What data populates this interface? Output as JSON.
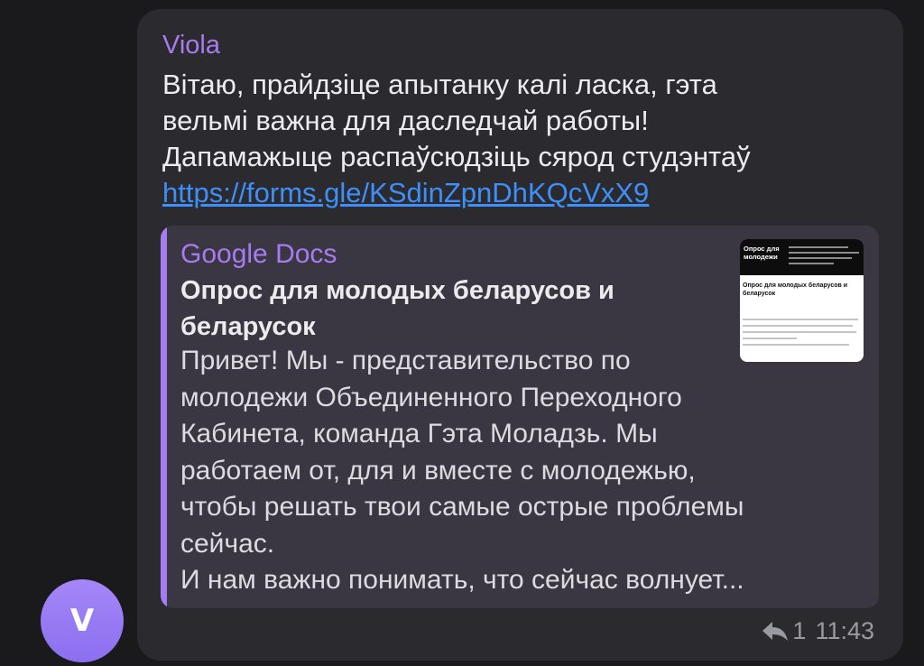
{
  "avatar": {
    "letter": "V",
    "color": "#9b7ef5"
  },
  "message": {
    "sender": "Viola",
    "sender_color": "#a67cf0",
    "text_lines": [
      "Вітаю, прайдзіце апытанку калі ласка, гэта",
      "вельмі важна для даследчай работы!",
      "Дапамажыце распаўсюдзіць сярод студэнтаў"
    ],
    "link": "https://forms.gle/KSdinZpnDhKQcVxX9",
    "link_color": "#3e8ff7"
  },
  "preview": {
    "site_name": "Google Docs",
    "title": "Опрос для молодых беларусов и беларусок",
    "description_lines": [
      "Привет! Мы - представительство по",
      "молодежи Объединенного Переходного",
      "Кабинета, команда Гэта Моладзь. Мы",
      "работаем от, для и вместе с молодежью,",
      "чтобы решать твои самые острые проблемы",
      "сейчас.",
      "И нам важно понимать, что сейчас волнует..."
    ],
    "thumbnail": {
      "header": "Опрос для молодежи",
      "title": "Опрос для молодых беларусов и беларусок"
    }
  },
  "meta": {
    "reply_icon": "reply-arrow-icon",
    "replies": "1",
    "time": "11:43"
  }
}
